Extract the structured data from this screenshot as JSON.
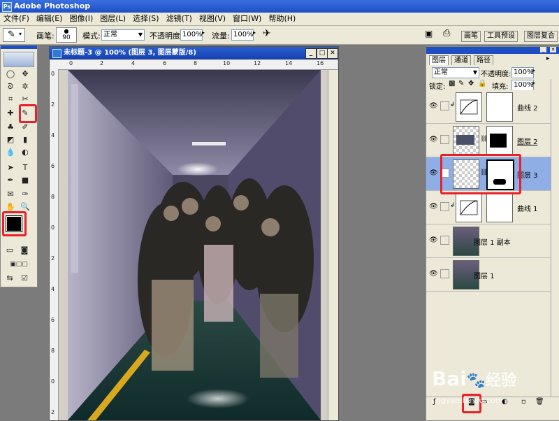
{
  "app": {
    "title": "Adobe Photoshop",
    "logo": "Ps"
  },
  "menu": [
    "文件(F)",
    "编辑(E)",
    "图像(I)",
    "图层(L)",
    "选择(S)",
    "滤镜(T)",
    "视图(V)",
    "窗口(W)",
    "帮助(H)"
  ],
  "options": {
    "brush_label": "画笔:",
    "brush_size": "90",
    "mode_label": "模式:",
    "mode_value": "正常",
    "opacity_label": "不透明度:",
    "opacity_value": "100%",
    "flow_label": "流量:",
    "flow_value": "100%",
    "dock_tabs": [
      "画笔",
      "工具预设",
      "图层复合"
    ]
  },
  "document": {
    "title": "未标题-3 @ 100% (图层 3, 图层蒙版/8)",
    "ruler_top": [
      "0",
      "2",
      "4",
      "6",
      "8",
      "10",
      "12",
      "14",
      "16"
    ],
    "ruler_left": [
      "0",
      "2",
      "4",
      "6",
      "8",
      "0",
      "2",
      "4",
      "6",
      "8",
      "0",
      "2"
    ]
  },
  "layers_panel": {
    "tabs": [
      "图层",
      "通道",
      "路径"
    ],
    "blend_mode": "正常",
    "opacity_label": "不透明度:",
    "opacity_value": "100%",
    "lock_label": "锁定:",
    "fill_label": "填充:",
    "fill_value": "100%",
    "layers": [
      {
        "name": "曲线 2",
        "kind": "adjustment"
      },
      {
        "name": "图层 2",
        "kind": "masked"
      },
      {
        "name": "图层 3",
        "kind": "masked",
        "selected": true
      },
      {
        "name": "曲线 1",
        "kind": "adjustment"
      },
      {
        "name": "图层 1 副本",
        "kind": "photo"
      },
      {
        "name": "图层 1",
        "kind": "photo"
      }
    ]
  },
  "watermark": {
    "brand": "Bai",
    "brand2": "经验",
    "url": "jingyan.baidu.com"
  },
  "colors": {
    "selection_red": "#e8202a",
    "title_blue": "#1d4fc4",
    "panel_bg": "#ece9d8",
    "selected_layer": "#8eaee5"
  }
}
